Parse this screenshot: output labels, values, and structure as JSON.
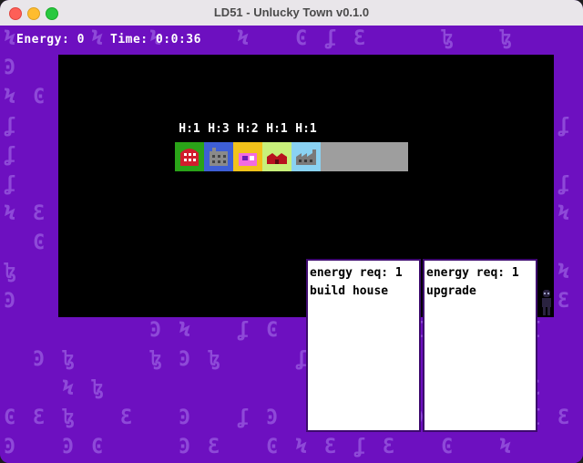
{
  "window": {
    "title": "LD51 - Unlucky Town v0.1.0"
  },
  "hud": {
    "energy": "Energy: 0",
    "time": "Time: 0:0:36"
  },
  "town": {
    "buildings": [
      {
        "label": "H:1",
        "icon": "house-icon",
        "bg": "#2aa318",
        "accent": "#d11d2d"
      },
      {
        "label": "H:3",
        "icon": "factory-icon",
        "bg": "#3e5fd6",
        "accent": "#8a8a8a"
      },
      {
        "label": "H:2",
        "icon": "shop-icon",
        "bg": "#f2c21a",
        "accent": "#f26be0"
      },
      {
        "label": "H:1",
        "icon": "barn-icon",
        "bg": "#c8f07a",
        "accent": "#b8121e"
      },
      {
        "label": "H:1",
        "icon": "mill-icon",
        "bg": "#8ad2f2",
        "accent": "#7a7a7a"
      }
    ],
    "empty_slots": 3
  },
  "cards": [
    {
      "requirement": "energy req: 1",
      "action": "build house"
    },
    {
      "requirement": "energy req: 1",
      "action": "upgrade"
    }
  ],
  "colors": {
    "background": "#6d10c0",
    "pattern": "#8e49d8",
    "viewport": "#000000",
    "card": "#ffffff"
  }
}
